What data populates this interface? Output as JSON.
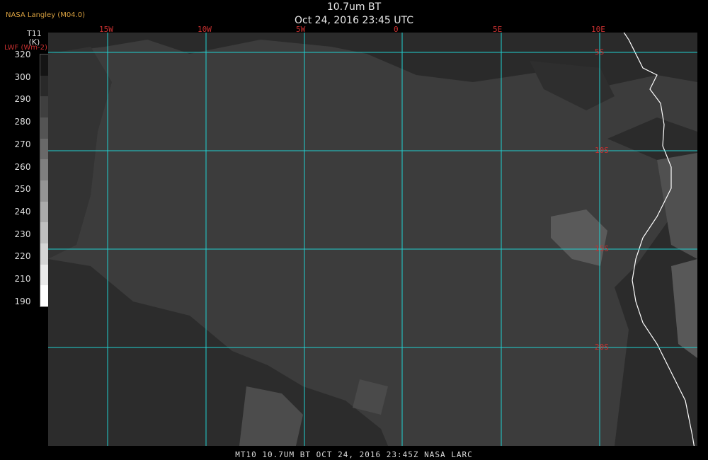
{
  "header": {
    "title": "10.7um BT",
    "datetime": "Oct 24, 2016 23:45 UTC",
    "producer": "NASA Langley (M04.0)"
  },
  "colorbar": {
    "unit_line1": "T11",
    "unit_line2": "(K)",
    "alt_unit": "LWF (Wm-2)",
    "ticks": [
      "320",
      "300",
      "290",
      "280",
      "270",
      "260",
      "250",
      "240",
      "230",
      "220",
      "210",
      "190"
    ]
  },
  "map": {
    "longitude_labels": [
      "15W",
      "10W",
      "5W",
      "0",
      "5E",
      "10E"
    ],
    "latitude_labels": [
      "5S",
      "10S",
      "15S",
      "20S"
    ],
    "grid_color": "#20d0d0",
    "label_color": "#c83030",
    "coast_color": "#ffffff"
  },
  "footer": {
    "caption": "MT10  10.7UM BT   OCT 24, 2016 23:45Z   NASA LARC"
  }
}
